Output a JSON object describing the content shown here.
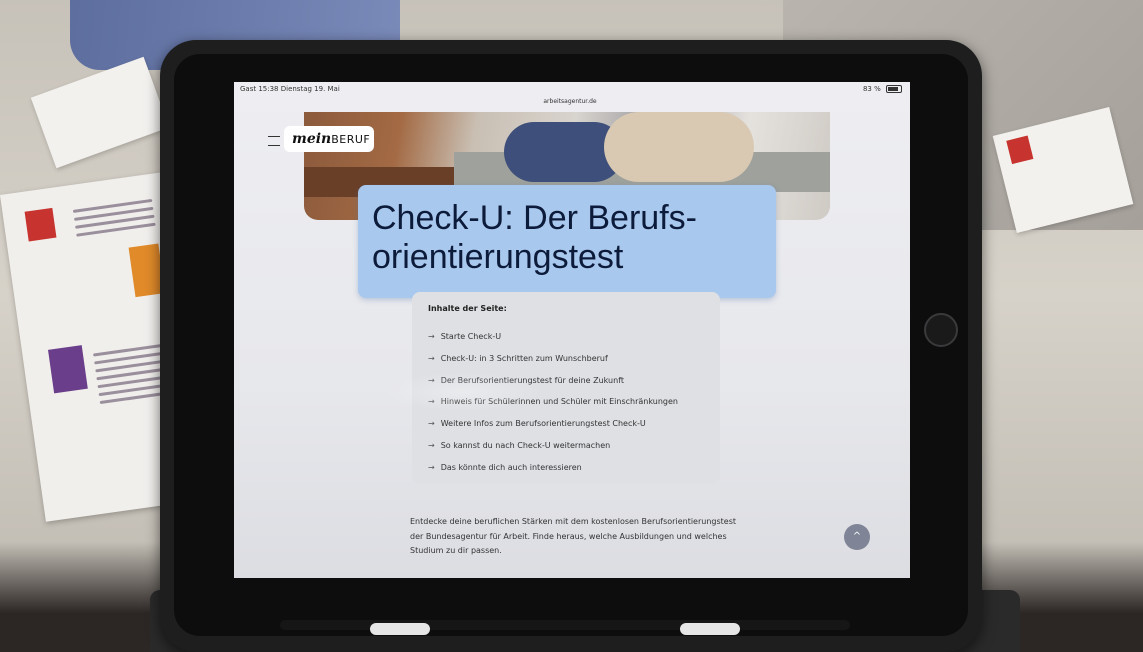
{
  "status_bar": {
    "left": "Gast  15:38  Dienstag 19. Mai",
    "battery": "83 %"
  },
  "browser": {
    "url": "arbeitsagentur.de"
  },
  "header": {
    "logo_mein": "mein",
    "logo_beruf": "BERUF"
  },
  "page": {
    "title": "Check-U: Der Berufs-orientierungstest",
    "toc_heading": "Inhalte der Seite:",
    "toc_items": [
      "Starte Check-U",
      "Check-U: in 3 Schritten zum Wunschberuf",
      "Der Berufsorientierungstest für deine Zukunft",
      "Hinweis für Schülerinnen und Schüler mit Einschränkungen",
      "Weitere Infos zum Berufsorientierungstest Check-U",
      "So kannst du nach Check-U weitermachen",
      "Das könnte dich auch interessieren"
    ],
    "intro": "Entdecke deine beruflichen Stärken mit dem kostenlosen Berufsorientierungstest der Bundesagentur für Arbeit. Finde heraus, welche Ausbildungen und welches Studium zu dir passen."
  },
  "icons": {
    "menu": "hamburger-icon",
    "arrow": "→",
    "scroll_up": "^"
  },
  "colors": {
    "title_box": "#a9c8ee",
    "toc_box": "#dfe0e4",
    "scroll_button": "#7f8596"
  }
}
